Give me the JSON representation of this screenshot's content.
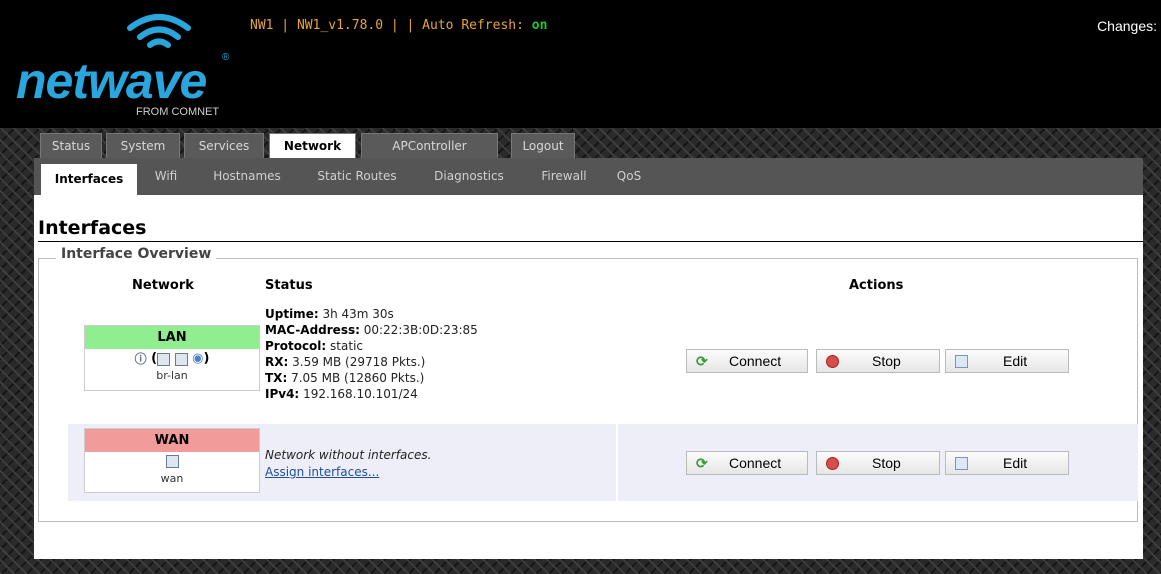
{
  "header": {
    "logo_word": "netwave",
    "logo_sub": "FROM COMNET",
    "logo_reg": "®",
    "info_prefix": "NW1 | NW1_v1.78.0 | | Auto Refresh: ",
    "auto_refresh_state": "on",
    "changes_label": "Changes:"
  },
  "colors": {
    "brand": "#29a6de",
    "header_text": "#e8a33c",
    "on_green": "#22c832",
    "lan_header": "#90ee90",
    "wan_header": "#f19b9b"
  },
  "tabs": [
    {
      "label": "Status",
      "active": false
    },
    {
      "label": "System",
      "active": false
    },
    {
      "label": "Services",
      "active": false
    },
    {
      "label": "Network",
      "active": true
    },
    {
      "label": "APController",
      "active": false
    },
    {
      "label": "Logout",
      "active": false
    }
  ],
  "subnav": [
    {
      "label": "Interfaces",
      "active": true
    },
    {
      "label": "Wifi",
      "active": false
    },
    {
      "label": "Hostnames",
      "active": false
    },
    {
      "label": "Static Routes",
      "active": false
    },
    {
      "label": "Diagnostics",
      "active": false
    },
    {
      "label": "Firewall",
      "active": false
    },
    {
      "label": "QoS",
      "active": false
    }
  ],
  "page": {
    "title": "Interfaces",
    "legend": "Interface Overview",
    "columns": {
      "network": "Network",
      "status": "Status",
      "actions": "Actions"
    }
  },
  "interfaces": [
    {
      "name": "LAN",
      "device": "br-lan",
      "icons": [
        "ethernet-icon",
        "port-icon",
        "port-icon",
        "wifi-icon"
      ],
      "status": [
        {
          "label": "Uptime:",
          "value": "3h 43m 30s"
        },
        {
          "label": "MAC-Address:",
          "value": "00:22:3B:0D:23:85"
        },
        {
          "label": "Protocol:",
          "value": "static"
        },
        {
          "label": "RX:",
          "value": "3.59 MB (29718 Pkts.)"
        },
        {
          "label": "TX:",
          "value": "7.05 MB (12860 Pkts.)"
        },
        {
          "label": "IPv4:",
          "value": "192.168.10.101/24"
        }
      ]
    },
    {
      "name": "WAN",
      "device": "wan",
      "icons": [
        "port-icon"
      ],
      "message": "Network without interfaces.",
      "link": "Assign interfaces..."
    }
  ],
  "actions": {
    "connect": "Connect",
    "stop": "Stop",
    "edit": "Edit"
  }
}
